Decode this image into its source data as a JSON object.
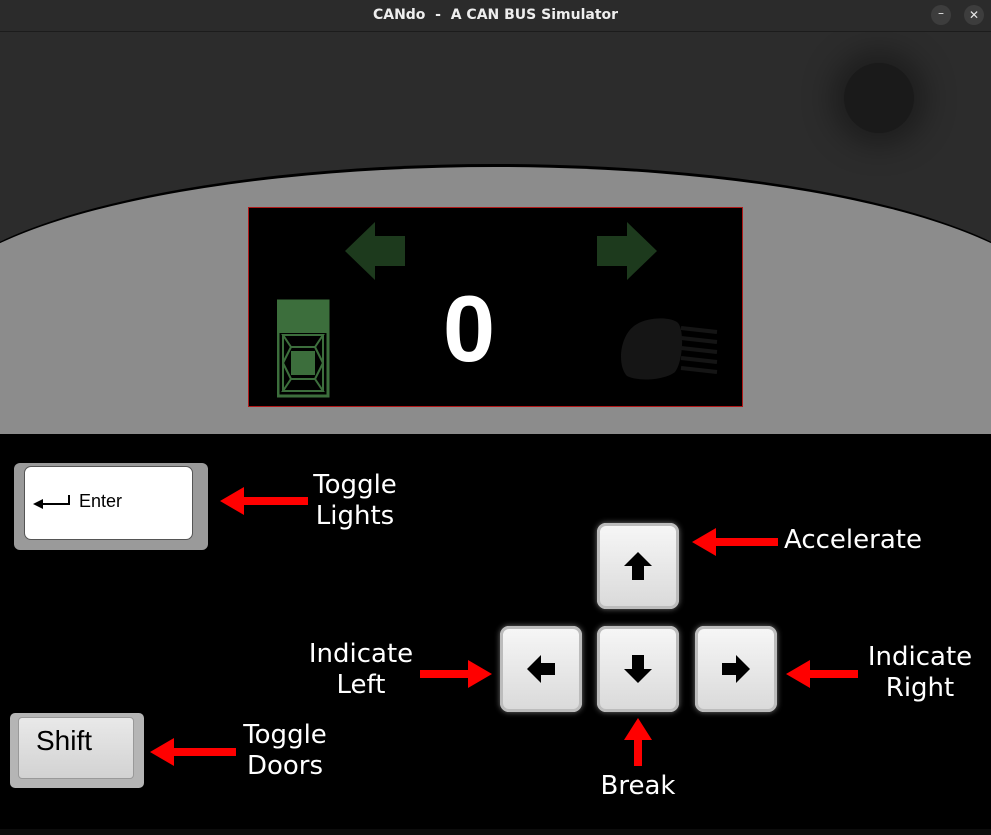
{
  "window": {
    "title": "CANdo  -  A CAN BUS Simulator",
    "minimize_glyph": "–",
    "close_glyph": "✕"
  },
  "dashboard": {
    "speed": "0",
    "indicator_color": "#1d3a1d",
    "car_icon_color": "#3c6e3c",
    "screen_border_color": "#b01818",
    "icons": [
      "turn-left-icon",
      "turn-right-icon",
      "car-doors-icon",
      "headlight-icon"
    ]
  },
  "keys": {
    "enter_label": "Enter",
    "shift_label": "Shift"
  },
  "labels": {
    "toggle_lights": "Toggle\nLights",
    "accelerate": "Accelerate",
    "indicate_left": "Indicate\nLeft",
    "indicate_right": "Indicate\nRight",
    "toggle_doors": "Toggle\nDoors",
    "break": "Break"
  },
  "colors": {
    "pointer": "#ff0000",
    "console": "#8c8c8c"
  }
}
